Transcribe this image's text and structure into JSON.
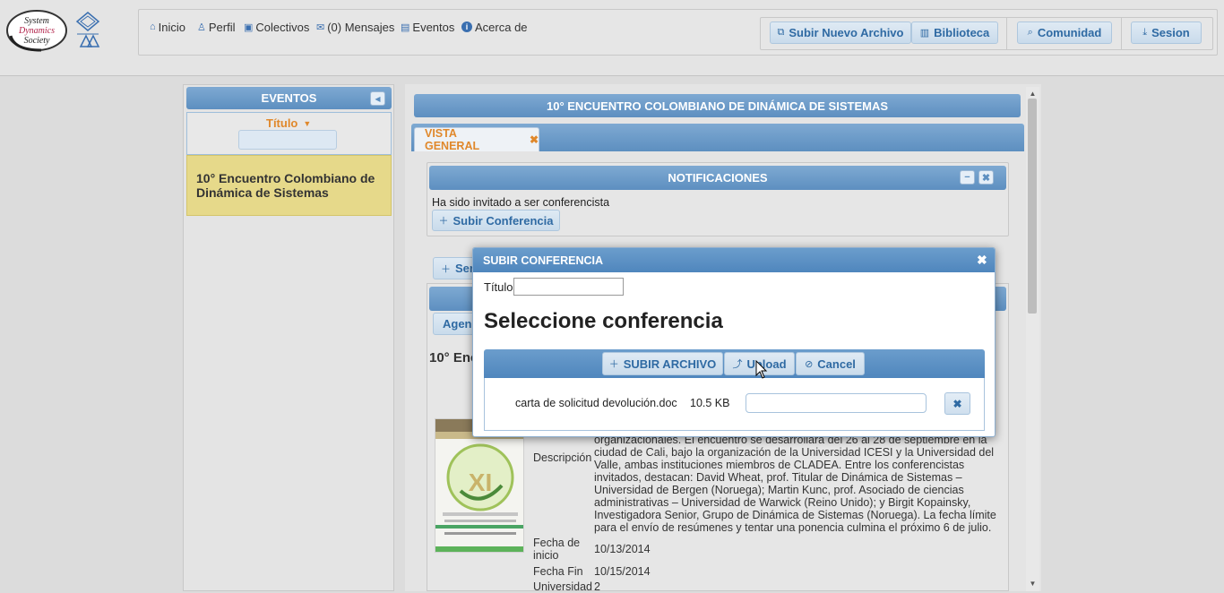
{
  "header": {
    "logo_text": [
      "System",
      "Dynamics",
      "Society"
    ],
    "nav": [
      {
        "label": "Inicio",
        "icon": "home-icon"
      },
      {
        "label": "Perfil",
        "icon": "user-icon"
      },
      {
        "label": "Colectivos",
        "icon": "group-icon"
      },
      {
        "label": "(0) Mensajes",
        "icon": "mail-icon"
      },
      {
        "label": "Eventos",
        "icon": "calendar-icon"
      },
      {
        "label": "Acerca de",
        "icon": "info-icon"
      }
    ],
    "actions": [
      {
        "label": "Subir Nuevo Archivo",
        "icon": "upload-file-icon"
      },
      {
        "label": "Biblioteca",
        "icon": "book-icon"
      },
      {
        "label": "Comunidad",
        "icon": "search-icon"
      },
      {
        "label": "Sesion",
        "icon": "download-icon"
      }
    ]
  },
  "sidebar": {
    "header": "EVENTOS",
    "filter_label": "Título",
    "events": [
      "10° Encuentro Colombiano de Dinámica de Sistemas"
    ]
  },
  "main": {
    "title": "10° ENCUENTRO COLOMBIANO DE DINÁMICA DE SISTEMAS",
    "tab": "VISTA GENERAL",
    "notifications": {
      "header": "NOTIFICACIONES",
      "message": "Ha sido invitado a ser conferencista",
      "button": "Subir Conferencia"
    },
    "partial_button_1": "Ser",
    "partial_button_2": "Agen",
    "event_title_partial": "10° Enc",
    "details": {
      "description_label": "Descripción",
      "description": "organizacionales. El encuentro se desarrollará del 26 al 28 de septiembre en la ciudad de Cali, bajo la organización de la Universidad ICESI y la Universidad del Valle, ambas instituciones miembros de CLADEA. Entre los conferencistas invitados, destacan: David Wheat, prof. Titular de Dinámica de Sistemas – Universidad de Bergen (Noruega); Martin Kunc, prof. Asociado de ciencias administrativas – Universidad de Warwick (Reino Unido); y Birgit Kopainsky, Investigadora Senior, Grupo de Dinámica de Sistemas (Noruega). La fecha límite para el envío de resúmenes y tentar una ponencia culmina el próximo 6 de julio.",
      "start_label": "Fecha de inicio",
      "start_value": "10/13/2014",
      "end_label": "Fecha Fin",
      "end_value": "10/15/2014",
      "univ_label": "Universidad",
      "univ_value": "2"
    },
    "poster_text": "XI"
  },
  "modal": {
    "title": "SUBIR CONFERENCIA",
    "titulo_label": "Título",
    "titulo_value": "",
    "heading": "Seleccione conferencia",
    "buttons": {
      "add": "SUBIR ARCHIVO",
      "upload": "Upload",
      "cancel": "Cancel"
    },
    "file": {
      "name": "carta de solicitud devolución.doc",
      "size": "10.5 KB"
    }
  },
  "colors": {
    "accent_blue": "#5d8fc0",
    "orange": "#e0882b",
    "selected_event": "#e6d98a"
  }
}
